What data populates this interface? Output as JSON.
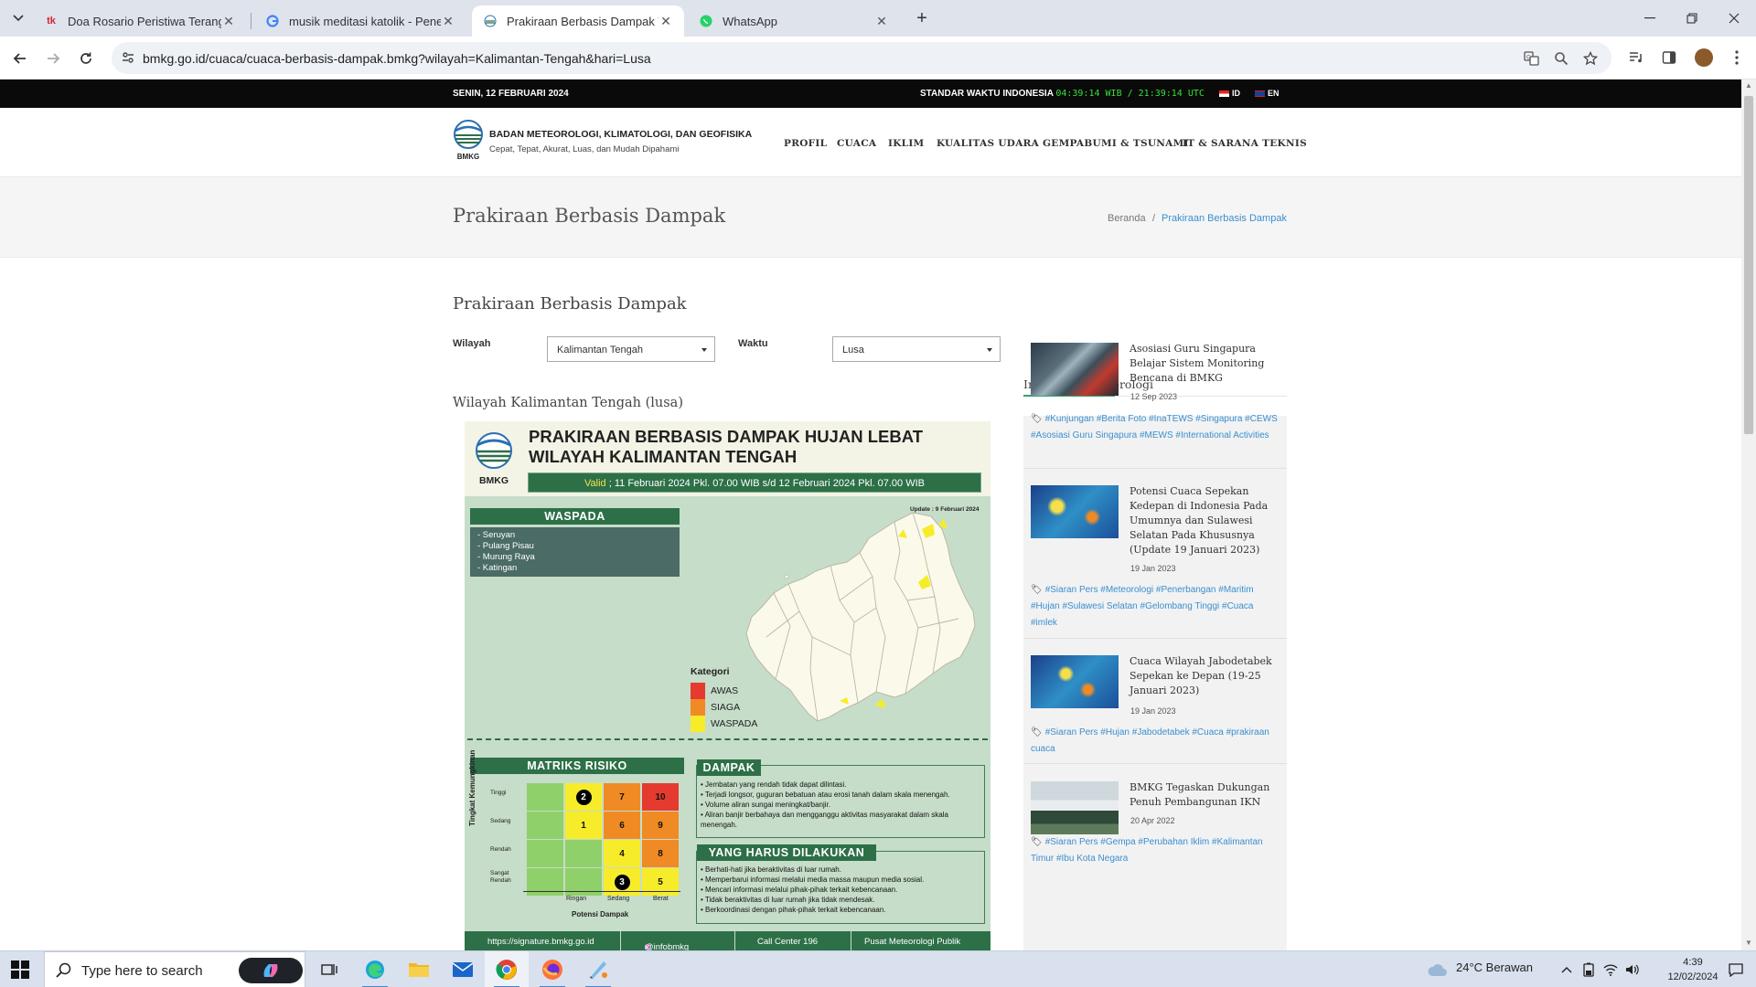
{
  "browser": {
    "tabs": [
      {
        "title": "Doa Rosario Peristiwa Terang - I",
        "favicon": "tk-icon"
      },
      {
        "title": "musik meditasi katolik - Penelu",
        "favicon": "google-icon"
      },
      {
        "title": "Prakiraan Berbasis Dampak Wi",
        "favicon": "bmkg-icon",
        "active": true
      },
      {
        "title": "WhatsApp",
        "favicon": "whatsapp-icon"
      }
    ],
    "url": "bmkg.go.id/cuaca/cuaca-berbasis-dampak.bmkg?wilayah=Kalimantan-Tengah&hari=Lusa"
  },
  "topbar": {
    "date": "SENIN, 12 FEBRUARI 2024",
    "time_label": "STANDAR WAKTU INDONESIA",
    "time_value": "04:39:14 WIB / 21:39:14 UTC",
    "lang_id": "ID",
    "lang_en": "EN"
  },
  "header": {
    "org_name": "BADAN METEOROLOGI, KLIMATOLOGI, DAN GEOFISIKA",
    "tagline": "Cepat, Tepat, Akurat, Luas, dan Mudah Dipahami",
    "logo_text": "BMKG",
    "menu": [
      "PROFIL",
      "CUACA",
      "IKLIM",
      "KUALITAS UDARA",
      "GEMPABUMI & TSUNAMI",
      "IT & SARANA TEKNIS"
    ]
  },
  "titlebar": {
    "title": "Prakiraan Berbasis Dampak",
    "breadcrumb_home": "Beranda",
    "breadcrumb_current": "Prakiraan Berbasis Dampak"
  },
  "main": {
    "heading": "Prakiraan Berbasis Dampak",
    "wilayah_label": "Wilayah",
    "wilayah_value": "Kalimantan Tengah",
    "waktu_label": "Waktu",
    "waktu_value": "Lusa",
    "subheading": "Wilayah Kalimantan Tengah (lusa)"
  },
  "infographic": {
    "title_line1": "PRAKIRAAN BERBASIS DAMPAK HUJAN LEBAT",
    "title_line2": "WILAYAH KALIMANTAN TENGAH",
    "logo_text": "BMKG",
    "valid_label": "Valid",
    "valid_text": " ; 11 Februari 2024 Pkl. 07.00 WIB s/d 12 Februari 2024 Pkl. 07.00 WIB",
    "update": "Update : 9 Februari 2024",
    "waspada_title": "WASPADA",
    "waspada_areas": [
      "- Seruyan",
      "- Pulang Pisau",
      "- Murung Raya",
      "- Katingan"
    ],
    "kategori_title": "Kategori",
    "kategori": [
      {
        "label": "AWAS",
        "color": "#e53a2f"
      },
      {
        "label": "SIAGA",
        "color": "#f08a24"
      },
      {
        "label": "WASPADA",
        "color": "#f6ec2a"
      }
    ],
    "matrix_title": "MATRIKS RISIKO",
    "matrix_rows": [
      "Tinggi",
      "Sedang",
      "Rendah",
      "Sangat Rendah"
    ],
    "matrix_cols": [
      "Ringan",
      "Sedang",
      "Berat"
    ],
    "matrix_y_label": "Tingkat Kemungkinan",
    "matrix_x_label": "Potensi Dampak",
    "matrix_cells": [
      [
        "",
        "2",
        "7",
        "10"
      ],
      [
        "",
        "1",
        "6",
        "9"
      ],
      [
        "",
        "",
        "4",
        "8"
      ],
      [
        "",
        "",
        "3",
        "5"
      ]
    ],
    "dampak_title": "DAMPAK",
    "dampak_items": [
      "• Jembatan yang rendah tidak dapat dilintasi.",
      "• Terjadi longsor, guguran bebatuan atau erosi tanah dalam skala menengah.",
      "• Volume aliran sungai meningkat/banjir.",
      "• Aliran banjir berbahaya dan mengganggu aktivitas masyarakat dalam skala",
      "  menengah."
    ],
    "yhd_title": "YANG HARUS DILAKUKAN",
    "yhd_items": [
      "• Berhati-hati jika beraktivitas di luar rumah.",
      "• Memperbarui informasi melalui media massa maupun media sosial.",
      "• Mencari informasi melalui pihak-pihak terkait kebencanaan.",
      "• Tidak beraktivitas di luar rumah jika tidak mendesak.",
      "• Berkoordinasi dengan pihak-pihak terkait kebencanaan."
    ],
    "footer": [
      "https://signature.bmkg.go.id",
      "@infobmkg",
      "Call Center 196",
      "Pusat Meteorologi Publik"
    ]
  },
  "sidebar": {
    "title": "Informasi Meteorologi",
    "news": [
      {
        "title": "Asosiasi Guru Singapura Belajar Sistem Monitoring Bencana di BMKG",
        "date": "12 Sep 2023",
        "tags": "#Kunjungan #Berita Foto #InaTEWS #Singapura #CEWS #Asosiasi Guru Singapura #MEWS #International Activities"
      },
      {
        "title": "Potensi Cuaca Sepekan Kedepan di Indonesia Pada Umumnya dan Sulawesi Selatan Pada Khususnya (Update 19 Januari 2023)",
        "date": "19 Jan 2023",
        "tags": "#Siaran Pers #Meteorologi #Penerbangan #Maritim #Hujan #Sulawesi Selatan #Gelombang Tinggi #Cuaca #imlek"
      },
      {
        "title": "Cuaca Wilayah Jabodetabek Sepekan ke Depan (19-25 Januari 2023)",
        "date": "19 Jan 2023",
        "tags": "#Siaran Pers #Hujan #Jabodetabek #Cuaca #prakiraan cuaca"
      },
      {
        "title": "BMKG Tegaskan Dukungan Penuh Pembangunan IKN",
        "date": "20 Apr 2022",
        "tags": "#Siaran Pers #Gempa #Perubahan Iklim #Kalimantan Timur #Ibu Kota Negara"
      }
    ]
  },
  "taskbar": {
    "search_placeholder": "Type here to search",
    "weather": "24°C  Berawan",
    "time": "4:39",
    "date": "12/02/2024"
  },
  "colors": {
    "bmkg_green": "#2d7048",
    "link_blue": "#3a8fd0",
    "awas": "#e53a2f",
    "siaga": "#f08a24",
    "waspada": "#f6ec2a",
    "low_risk": "#8fd06a"
  }
}
